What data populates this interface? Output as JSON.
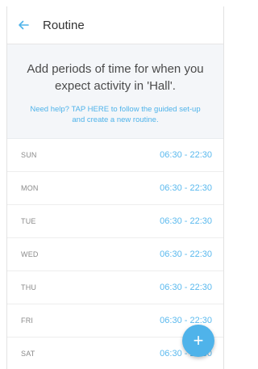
{
  "header": {
    "title": "Routine",
    "accent": "#4fb3ea"
  },
  "intro": {
    "main": "Add periods of time for when you expect activity in 'Hall'.",
    "help": "Need help? TAP HERE to follow the guided set-up and create a new routine."
  },
  "schedule": [
    {
      "day": "SUN",
      "time": "06:30 - 22:30"
    },
    {
      "day": "MON",
      "time": "06:30 - 22:30"
    },
    {
      "day": "TUE",
      "time": "06:30 - 22:30"
    },
    {
      "day": "WED",
      "time": "06:30 - 22:30"
    },
    {
      "day": "THU",
      "time": "06:30 - 22:30"
    },
    {
      "day": "FRI",
      "time": "06:30 - 22:30"
    },
    {
      "day": "SAT",
      "time": "06:30 - 22:30"
    }
  ],
  "fab": {
    "label": "+"
  }
}
